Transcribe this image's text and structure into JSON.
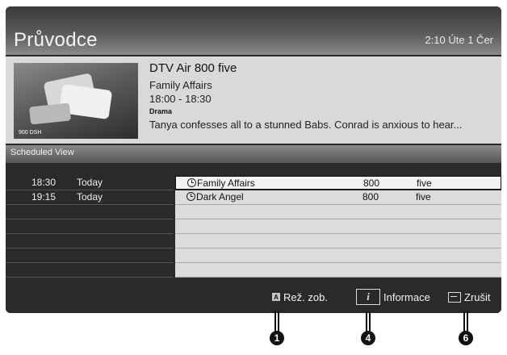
{
  "header": {
    "title": "Průvodce",
    "clock": "2:10 Úte 1 Čer"
  },
  "program": {
    "thumb_watermark": "900 DSH",
    "channel": "DTV Air 800 five",
    "title": "Family Affairs",
    "time": "18:00 - 18:30",
    "genre": "Drama",
    "synopsis": "Tanya confesses all to a stunned Babs. Conrad is anxious to hear..."
  },
  "section_title": "Scheduled View",
  "schedule": [
    {
      "time": "18:30",
      "day": "Today",
      "name": "Family Affairs",
      "num": "800",
      "channel": "five"
    },
    {
      "time": "19:15",
      "day": "Today",
      "name": "Dark Angel",
      "num": "800",
      "channel": "five"
    }
  ],
  "buttons": {
    "view_mode": {
      "key": "A",
      "label": "Rež. zob."
    },
    "info": {
      "key": "i",
      "label": "Informace"
    },
    "cancel": {
      "label": "Zrušit"
    }
  },
  "callouts": [
    "1",
    "4",
    "6"
  ]
}
